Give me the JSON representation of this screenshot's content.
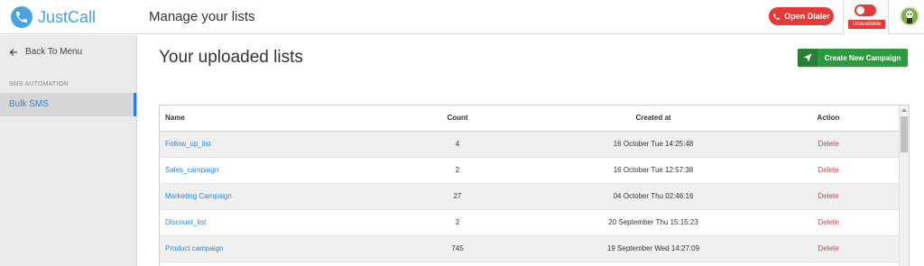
{
  "app": {
    "name": "JustCall",
    "page_title": "Manage your lists"
  },
  "header": {
    "open_dialer_label": "Open Dialer",
    "status_label": "Unavailable"
  },
  "sidebar": {
    "back_label": "Back To Menu",
    "section_label": "SMS AUTOMATION",
    "items": [
      {
        "label": "Bulk SMS",
        "active": true
      }
    ]
  },
  "main": {
    "title": "Your uploaded lists",
    "create_button_label": "Create New Campaign",
    "table": {
      "columns": [
        "Name",
        "Count",
        "Created at",
        "Action"
      ],
      "rows": [
        {
          "name": "Follow_up_list",
          "count": "4",
          "created_at": "16 October Tue 14:25:48",
          "action": "Delete"
        },
        {
          "name": "Sales_campaign",
          "count": "2",
          "created_at": "16 October Tue 12:57:38",
          "action": "Delete"
        },
        {
          "name": "Marketing Campaign",
          "count": "27",
          "created_at": "04 October Thu 02:46:16",
          "action": "Delete"
        },
        {
          "name": "Discount_list",
          "count": "2",
          "created_at": "20 September Thu 15:15:23",
          "action": "Delete"
        },
        {
          "name": "Product campaign",
          "count": "745",
          "created_at": "19 September Wed 14:27:09",
          "action": "Delete"
        }
      ]
    }
  },
  "colors": {
    "brand": "#4aa3df",
    "danger": "#e53935",
    "success": "#2e9a3f",
    "link": "#1e88e5"
  },
  "icons": [
    "phone-icon",
    "arrow-left-icon",
    "paper-plane-icon",
    "avatar"
  ]
}
